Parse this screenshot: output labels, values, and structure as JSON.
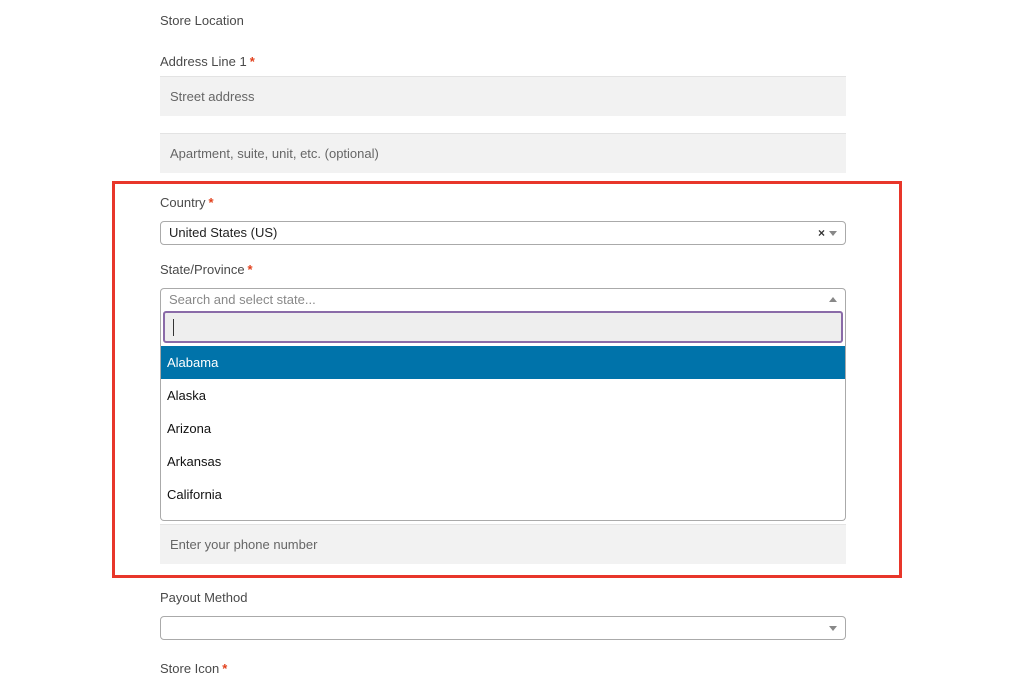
{
  "form": {
    "store_location_label": "Store Location",
    "address1_label": "Address Line 1",
    "required_mark": "*",
    "address1_placeholder": "Street address",
    "address2_placeholder": "Apartment, suite, unit, etc. (optional)",
    "country_label": "Country",
    "country_value": "United States (US)",
    "clear_symbol": "×",
    "state_label": "State/Province",
    "state_placeholder": "Search and select state...",
    "state_options": [
      "Alabama",
      "Alaska",
      "Arizona",
      "Arkansas",
      "California"
    ],
    "phone_placeholder": "Enter your phone number",
    "payout_label": "Payout Method",
    "payout_value": "",
    "store_icon_label": "Store Icon"
  },
  "colors": {
    "highlight_border": "#e8362a",
    "active_option": "#0073aa",
    "required": "#e2401c"
  }
}
